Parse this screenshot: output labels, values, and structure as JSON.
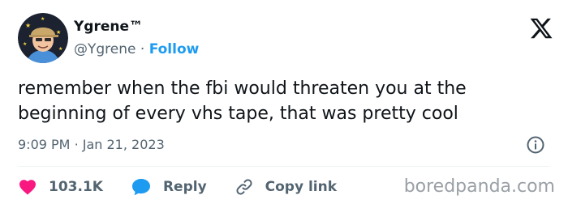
{
  "author": {
    "display_name": "Ygrene",
    "name_suffix": "™",
    "handle": "@Ygrene",
    "separator": "·",
    "follow_label": "Follow"
  },
  "tweet": {
    "text": "remember when the fbi would threaten you at the beginning of every vhs tape, that was pretty cool",
    "time": "9:09 PM",
    "separator": "·",
    "date": "Jan 21, 2023"
  },
  "actions": {
    "like_count": "103.1K",
    "reply_label": "Reply",
    "copy_link_label": "Copy link"
  },
  "watermark": "boredpanda.com",
  "icons": {
    "logo": "x-logo-icon",
    "info": "info-icon",
    "like": "heart-icon",
    "reply": "chat-bubble-icon",
    "copy_link": "link-icon"
  },
  "colors": {
    "accent": "#1d9bf0",
    "like": "#f91880",
    "text": "#0f1419",
    "secondary_text": "#536471",
    "watermark": "#9aa0a6"
  }
}
